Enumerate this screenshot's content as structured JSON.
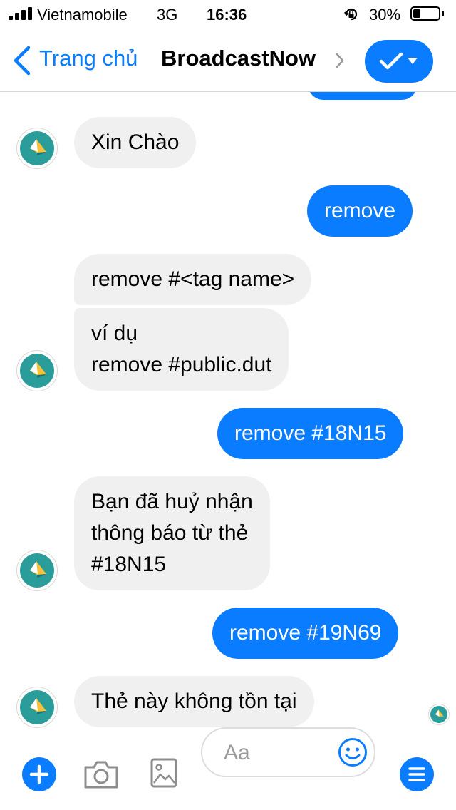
{
  "status_bar": {
    "carrier": "Vietnamobile",
    "network": "3G",
    "time": "16:36",
    "battery": "30%",
    "battery_level": 0.3
  },
  "nav": {
    "back_label": "Trang chủ",
    "title": "BroadcastNow",
    "accent_color": "#0a7cff"
  },
  "messages": [
    {
      "sender": "bot",
      "text": "Xin Chào"
    },
    {
      "sender": "user",
      "text": "remove"
    },
    {
      "sender": "bot",
      "text": "remove #<tag name>"
    },
    {
      "sender": "bot",
      "lines": [
        "ví dụ",
        "remove #public.dut"
      ]
    },
    {
      "sender": "user",
      "text": "remove #18N15"
    },
    {
      "sender": "bot",
      "lines": [
        "Bạn đã huỷ nhận",
        "thông báo từ thẻ",
        "#18N15"
      ]
    },
    {
      "sender": "user",
      "text": "remove #19N69"
    },
    {
      "sender": "bot",
      "text": "Thẻ này không tồn tại"
    }
  ],
  "composer": {
    "placeholder": "Aa"
  },
  "icons": {
    "back": "chevron-left-icon",
    "title_chevron": "chevron-right-icon",
    "action": "checkmark-icon",
    "action_dropdown": "caret-down-icon",
    "add": "plus-icon",
    "camera": "camera-icon",
    "gallery": "image-icon",
    "emoji": "smiley-icon",
    "menu": "menu-icon",
    "avatar": "broadcast-logo-icon"
  }
}
